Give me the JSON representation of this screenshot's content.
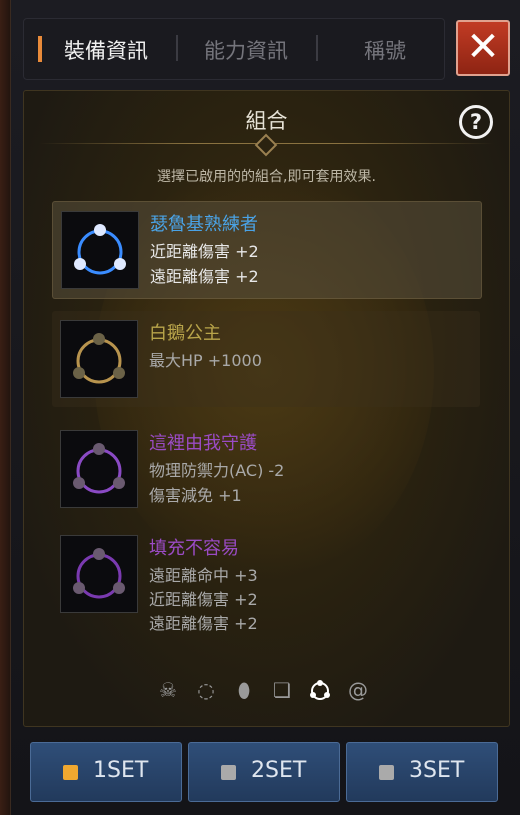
{
  "tabs": [
    "裝備資訊",
    "能力資訊",
    "稱號"
  ],
  "panel": {
    "title": "組合",
    "instruction": "選擇已啟用的的組合,即可套用效果."
  },
  "sets": [
    {
      "name": "瑟魯基熟練者",
      "name_color": "#4aa3e6",
      "effect_color": "#e8e8e8",
      "ring_color": "#3a8cff",
      "effects": [
        "近距離傷害 +2",
        "遠距離傷害 +2"
      ]
    },
    {
      "name": "白鵝公主",
      "name_color": "#b8a44a",
      "effect_color": "#a9a9a9",
      "ring_color": "#b8944e",
      "effects": [
        "最大HP +1000"
      ]
    },
    {
      "name": "這裡由我守護",
      "name_color": "#9a4bc4",
      "effect_color": "#a9a9a9",
      "ring_color": "#8a4ac4",
      "effects": [
        "物理防禦力(AC) -2",
        "傷害減免 +1"
      ]
    },
    {
      "name": "填充不容易",
      "name_color": "#9a4bc4",
      "effect_color": "#a9a9a9",
      "ring_color": "#7a3ab0",
      "effects": [
        "遠距離命中 +3",
        "近距離傷害 +2",
        "遠距離傷害 +2"
      ]
    }
  ],
  "bottom_icons": [
    "skull-crossbones-icon",
    "necklace-icon",
    "gem-icon",
    "scroll-icon",
    "set-ring-icon",
    "swirl-icon"
  ],
  "set_buttons": [
    {
      "label": "1SET",
      "marker_color": "#f0a830"
    },
    {
      "label": "2SET",
      "marker_color": "#aaaaaa"
    },
    {
      "label": "3SET",
      "marker_color": "#aaaaaa"
    }
  ]
}
